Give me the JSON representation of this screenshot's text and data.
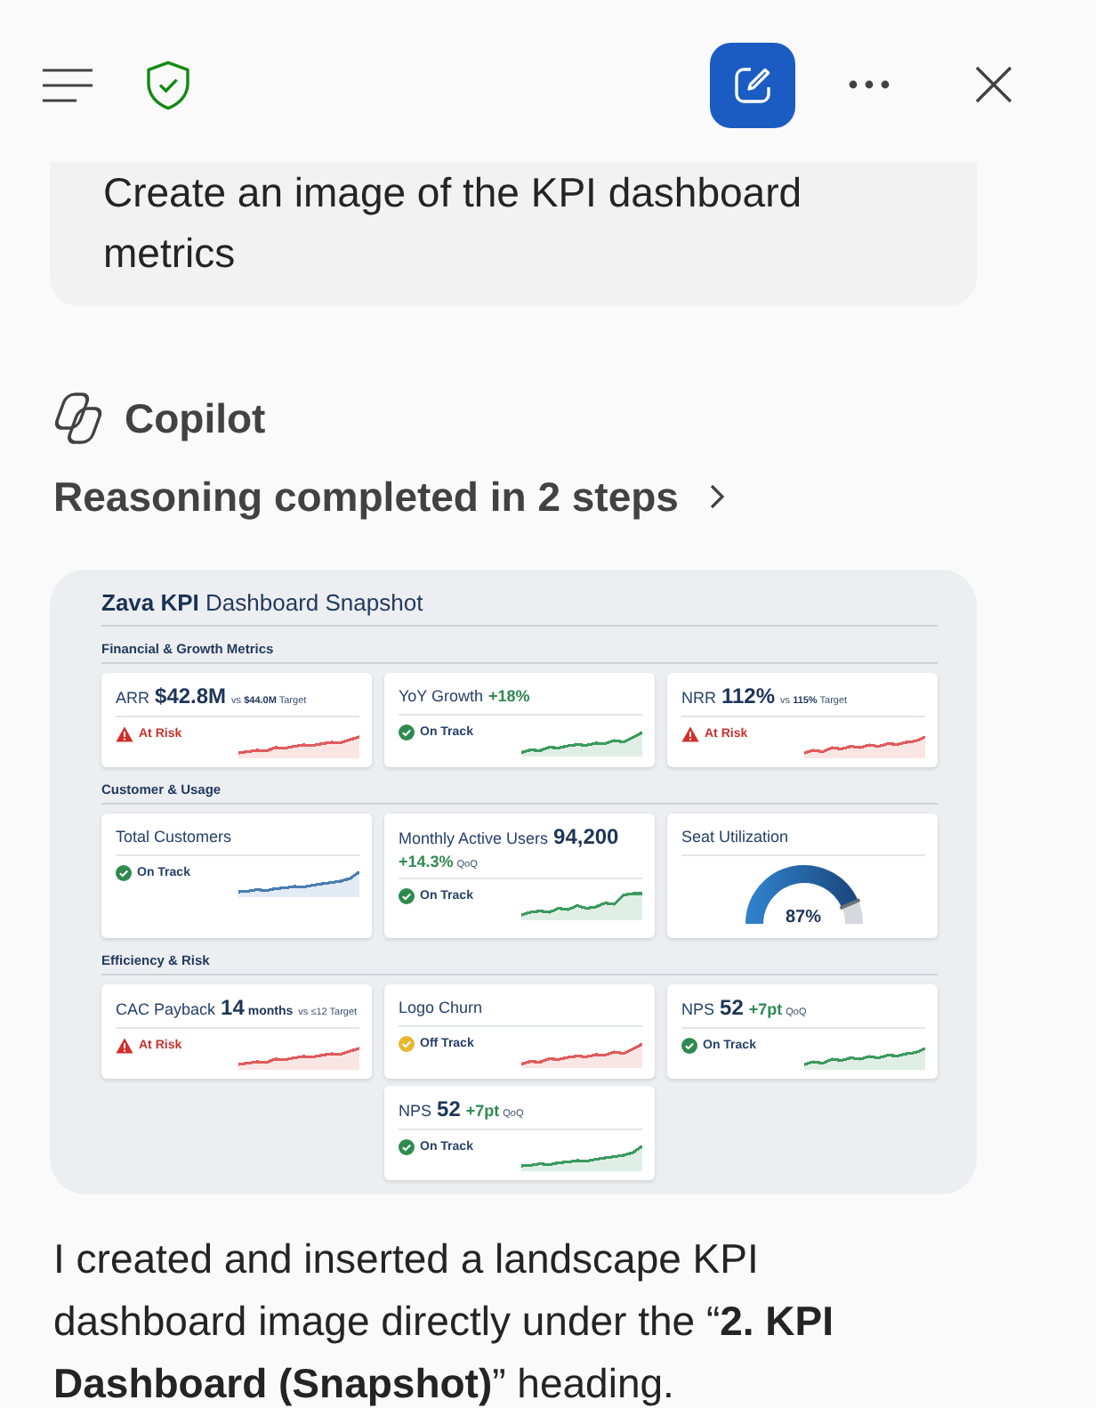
{
  "user_message": {
    "text": "Create an image of the KPI dashboard metrics"
  },
  "assistant": {
    "name": "Copilot",
    "reasoning": {
      "label": "Reasoning completed in 2 steps",
      "expanded": false
    }
  },
  "image": {
    "title": "**Zava KPI** Dashboard Snapshot",
    "sections": [
      {
        "title": "Financial & Growth Metrics",
        "cards": [
          {
            "kind": "metric",
            "label": "ARR",
            "value": "$42.8M",
            "note": "vs **$44.0M** Target",
            "status": {
              "kind": "at_risk",
              "label": "At Risk"
            },
            "color": "#e05c5c"
          },
          {
            "kind": "metric",
            "label": "YoY Growth",
            "change": "+18%",
            "status": {
              "kind": "on_track",
              "label": "On Track"
            },
            "color": "#3c9a5f"
          },
          {
            "kind": "metric",
            "label": "NRR",
            "value": "112%",
            "note": "vs **115%** Target",
            "status": {
              "kind": "at_risk",
              "label": "At Risk"
            },
            "color": "#e05c5c"
          }
        ]
      },
      {
        "title": "Customer & Usage",
        "cards": [
          {
            "kind": "metric",
            "label": "Total Customers",
            "status": {
              "kind": "on_track",
              "label": "On Track"
            },
            "color": "#4a7db3"
          },
          {
            "kind": "metric",
            "label": "Monthly Active Users",
            "value": "94,200",
            "change": "+14.3%",
            "note": "QoQ",
            "status": {
              "kind": "on_track",
              "label": "On Track"
            },
            "color": "#3c9a5f"
          },
          {
            "kind": "gauge",
            "label": "Seat Utilization",
            "level": 0.87,
            "reading": "87%"
          }
        ]
      },
      {
        "title": "Efficiency & Risk",
        "cards": [
          {
            "kind": "metric",
            "label": "CAC Payback",
            "value": "14",
            "unit": "months",
            "note": "vs ≤12 Target",
            "status": {
              "kind": "at_risk",
              "label": "At Risk"
            },
            "color": "#e05c5c"
          },
          {
            "kind": "metric",
            "label": "Logo Churn",
            "status": {
              "kind": "off_track",
              "label": "Off Track"
            },
            "color": "#e05c5c"
          },
          {
            "kind": "metric",
            "label": "NPS",
            "value": "52",
            "change": "+7pt",
            "note": "QoQ",
            "status": {
              "kind": "on_track",
              "label": "On Track"
            },
            "color": "#3c9a5f"
          },
          {
            "kind": "metric",
            "label": "NPS",
            "value": "52",
            "change": "+7pt",
            "note": "QoQ",
            "status": {
              "kind": "on_track",
              "label": "On Track"
            },
            "color": "#3c9a5f"
          }
        ]
      }
    ]
  },
  "response": "I created and inserted a landscape KPI dashboard image directly under the “**2. KPI Dashboard (Snapshot)**” heading."
}
